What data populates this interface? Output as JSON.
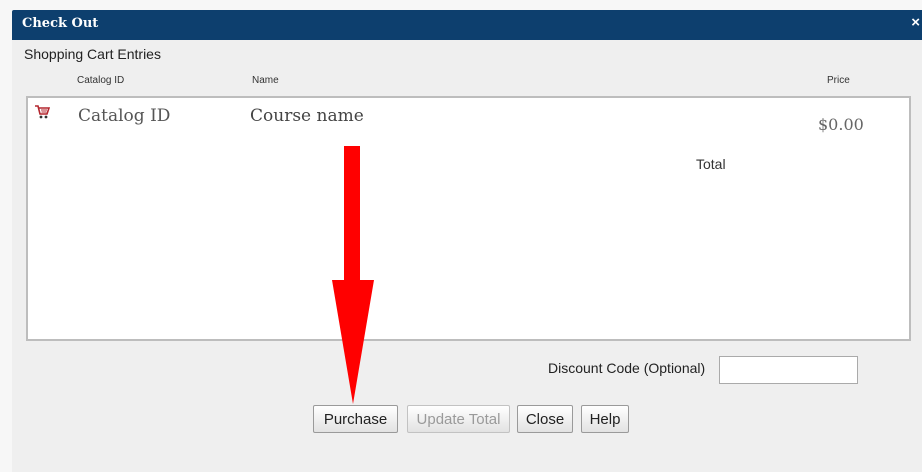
{
  "dialog": {
    "title": "Check Out",
    "close_glyph": "×"
  },
  "cart": {
    "heading": "Shopping Cart Entries",
    "columns": {
      "catalog_id": "Catalog ID",
      "name": "Name",
      "price": "Price"
    },
    "rows": [
      {
        "catalog_id": "Catalog ID",
        "name": "Course name",
        "price": "$0.00",
        "icon": "cart-icon"
      }
    ],
    "total_label": "Total"
  },
  "discount": {
    "label": "Discount Code (Optional)",
    "value": ""
  },
  "buttons": {
    "purchase": "Purchase",
    "update_total": "Update Total",
    "close": "Close",
    "help": "Help"
  },
  "colors": {
    "titlebar": "#0d3f6e",
    "arrow": "#ff0000",
    "cart_icon": "#b3262e"
  }
}
